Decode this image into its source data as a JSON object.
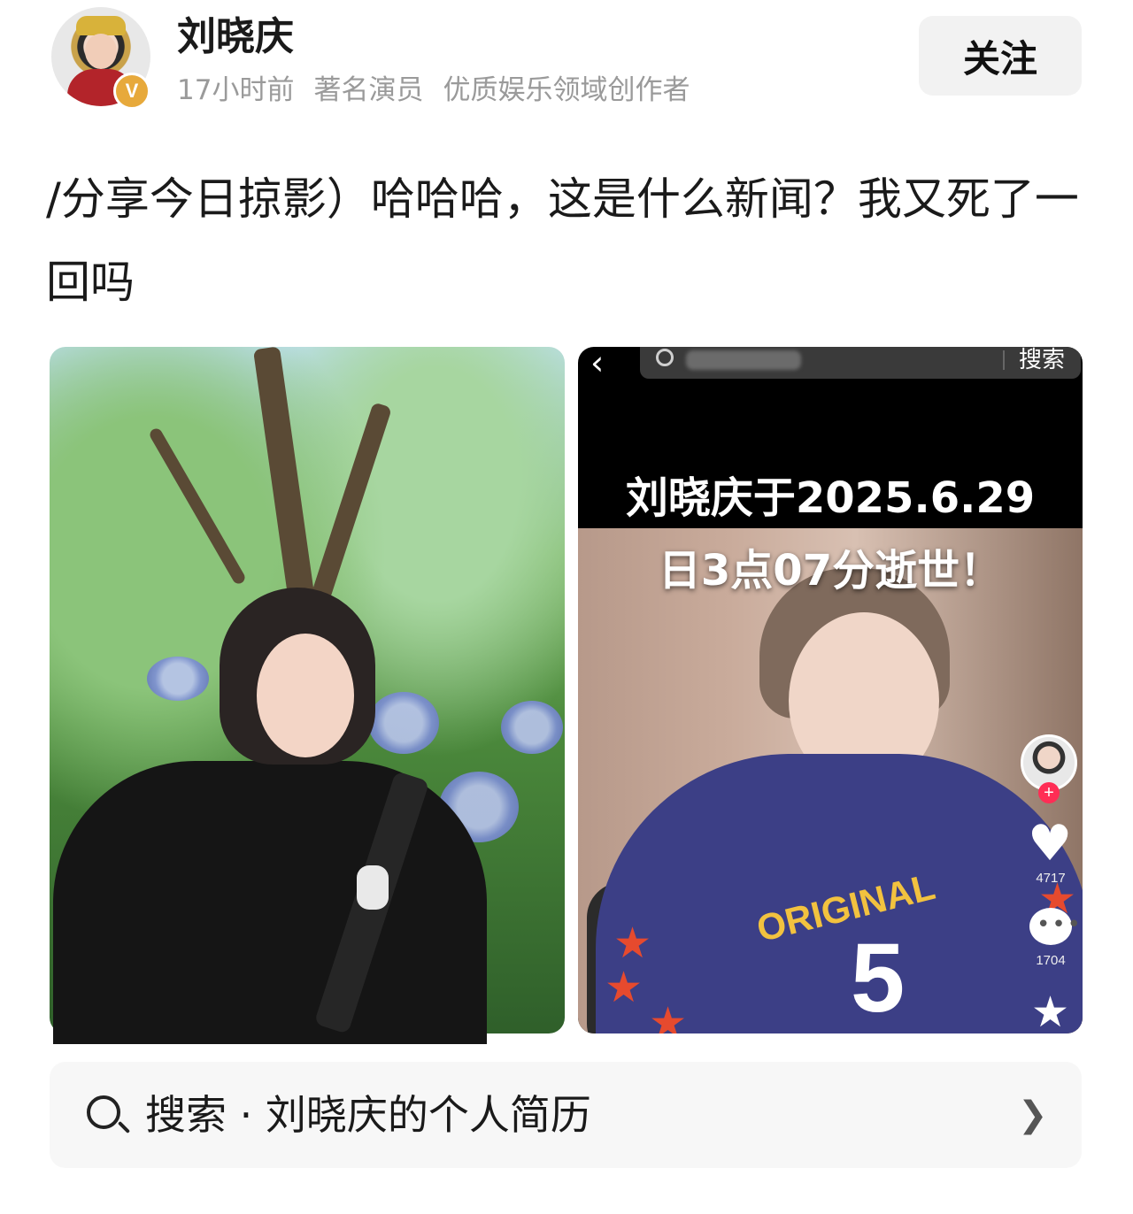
{
  "author": {
    "name": "刘晓庆",
    "verified_badge": "V",
    "time": "17小时前",
    "titles": [
      "著名演员",
      "优质娱乐领域创作者"
    ]
  },
  "follow_label": "关注",
  "post": {
    "text": "/分享今日掠影）哈哈哈，这是什么新闻？我又死了一回吗"
  },
  "video": {
    "search_button": "搜索",
    "back_icon": "‹",
    "caption_line1": "刘晓庆于2025.6.29",
    "caption_line2": "日3点07分逝世！",
    "shirt_text": "ORIGINAL",
    "shirt_number": "5",
    "like_count": "4717",
    "comment_count": "1704",
    "side_plus": "+"
  },
  "search_suggestion": {
    "label": "搜索 · 刘晓庆的个人简历"
  },
  "colors": {
    "badge": "#e7a93b",
    "follow_bg": "#f2f2f2",
    "meta_text": "#9a9a9a",
    "search_bg": "#f7f7f7"
  }
}
